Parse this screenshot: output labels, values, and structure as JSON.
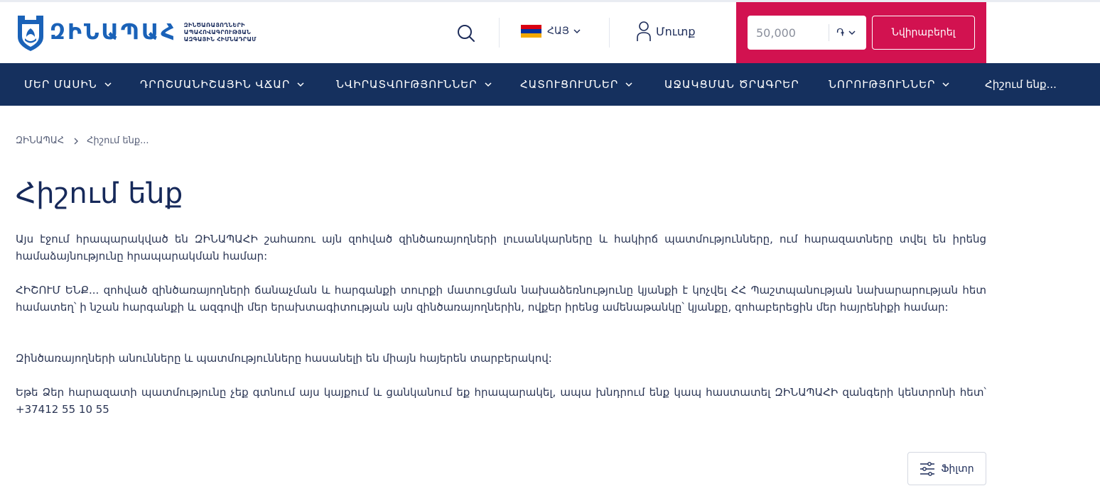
{
  "header": {
    "logo_text": "ԶԻՆԱՊԱՀ",
    "logo_subtitle": [
      "ԶԻՆԾԱՌԱՅՈՂՆԵՐԻ",
      "ԱՊԱՀՈՎԱԳՐՈՒԹՅԱՆ",
      "ԱԶԳԱՅԻՆ ՀԻՄՆԱԴՐԱՄ"
    ],
    "language": "ՀԱՅ",
    "login_label": "Մուտք",
    "amount_placeholder": "50,000",
    "currency": "֏",
    "donate_label": "Նվիրաբերել"
  },
  "nav": {
    "items": [
      {
        "label": "ՄԵՐ ՄԱՍԻՆ",
        "dropdown": true
      },
      {
        "label": "ԴՐՈՇՄԱՆԻՇԱՅԻՆ ՎՃԱՐ",
        "dropdown": true
      },
      {
        "label": "ՆՎԻՐԱՏՎՈՒԹՅՈՒՆՆԵՐ",
        "dropdown": true
      },
      {
        "label": "ՀԱՏՈՒՑՈՒՄՆԵՐ",
        "dropdown": true
      },
      {
        "label": "ԱՋԱԿՑՄԱՆ ԾՐԱԳՐԵՐ",
        "dropdown": false
      },
      {
        "label": "ՆՈՐՈՒԹՅՈՒՆՆԵՐ",
        "dropdown": true
      },
      {
        "label": "Հիշում ենք...",
        "dropdown": false
      }
    ]
  },
  "breadcrumb": {
    "home": "ԶԻՆԱՊԱՀ",
    "current": "Հիշում ենք..."
  },
  "page": {
    "title": "Հիշում ենք",
    "paragraphs": [
      "Այս էջում հրապարակված են ԶԻՆԱՊԱՀԻ շահառու այն զոհված զինծառայողների լուսանկարները և հակիրճ պատմությունները, ում հարազատները տվել են իրենց համաձայնությունը հրապարակման համար:",
      "ՀԻՇՈՒՄ ԵՆՔ... զոհված զինծառայողների ճանաչման և հարգանքի տուրքի մատուցման նախաձեռնությունը կյանքի է կոչվել ՀՀ Պաշտպանության նախարարության հետ համատեղ՝ ի նշան հարգանքի և ազգովի մեր երախտագիտության այն զինծառայողներին, ովքեր իրենց ամենաթանկը՝ կյանքը, զոհաբերեցին մեր հայրենիքի համար:",
      "Զինծառայողների անունները և պատմությունները հասանելի են միայն հայերեն տարբերակով:",
      "Եթե Ձեր հարազատի պատմությունը չեք գտնում այս կայքում և ցանկանում եք հրապարակել, ապա խնդրում ենք կապ հաստատել ԶԻՆԱՊԱՀԻ զանգերի կենտրոնի հետ՝ +37412 55 10 55"
    ],
    "filter_label": "Ֆիլտր"
  },
  "colors": {
    "nav_bg": "#15305e",
    "accent": "#d21250",
    "logo_blue": "#1a62b8"
  }
}
